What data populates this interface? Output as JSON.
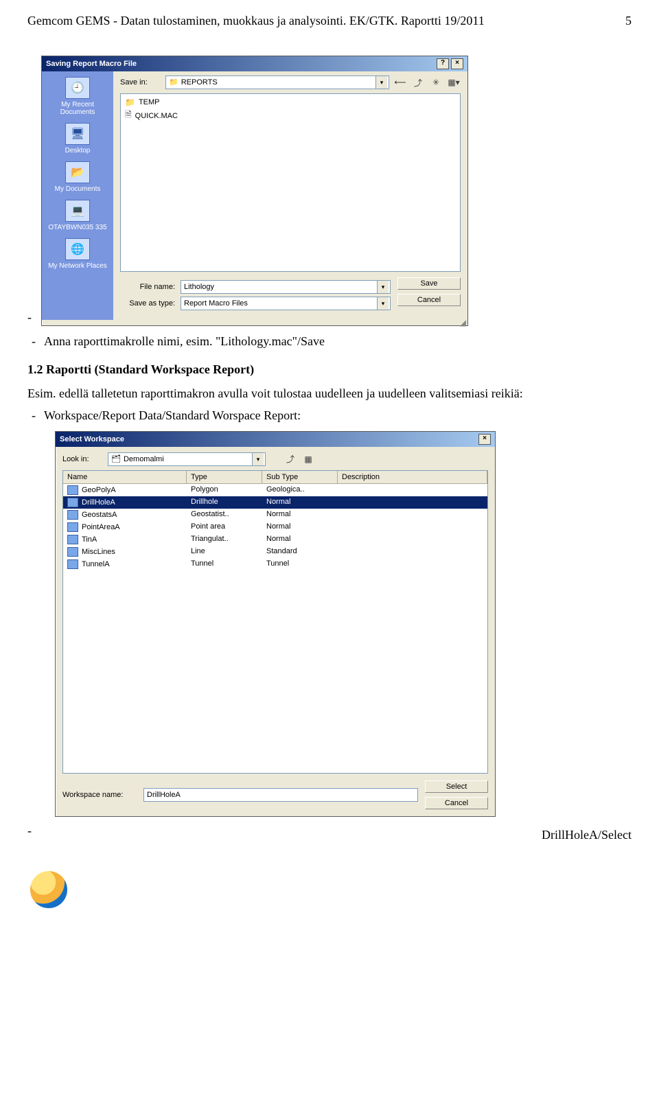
{
  "header": {
    "title": "Gemcom GEMS - Datan tulostaminen, muokkaus ja analysointi. EK/GTK. Raportti 19/2011",
    "page_number": "5"
  },
  "dlg1": {
    "title": "Saving Report Macro File",
    "save_in_label": "Save in:",
    "save_in_value": "REPORTS",
    "toolbar_icons": [
      "back-icon",
      "up-icon",
      "new-folder-icon",
      "views-icon"
    ],
    "places": [
      "My Recent Documents",
      "Desktop",
      "My Documents",
      "OTAYBWN035 335",
      "My Network Places"
    ],
    "files": [
      {
        "name": "TEMP",
        "kind": "folder"
      },
      {
        "name": "QUICK.MAC",
        "kind": "file"
      }
    ],
    "file_name_label": "File name:",
    "file_name_value": "Lithology",
    "save_type_label": "Save as type:",
    "save_type_value": "Report Macro Files",
    "save_btn": "Save",
    "cancel_btn": "Cancel"
  },
  "text": {
    "bullet_anna": "Anna raporttimakrolle nimi, esim. \"Lithology.mac\"/Save",
    "section_1_2": "1.2   Raportti  (Standard Workspace Report)",
    "esim_line": "Esim. edellä talletetun raporttimakron avulla voit tulostaa uudelleen ja uudelleen valitsemiasi reikiä:",
    "bullet_workspace": "Workspace/Report Data/Standard Worspace Report:",
    "drillhole_select": "DrillHoleA/Select"
  },
  "dlg2": {
    "title": "Select Workspace",
    "look_in_label": "Look in:",
    "look_in_value": "Demomalmi",
    "columns": [
      "Name",
      "Type",
      "Sub Type",
      "Description"
    ],
    "rows": [
      {
        "name": "GeoPolyA",
        "type": "Polygon",
        "sub": "Geologica..",
        "desc": "",
        "selected": false
      },
      {
        "name": "DrillHoleA",
        "type": "Drillhole",
        "sub": "Normal",
        "desc": "",
        "selected": true
      },
      {
        "name": "GeostatsA",
        "type": "Geostatist..",
        "sub": "Normal",
        "desc": "",
        "selected": false
      },
      {
        "name": "PointAreaA",
        "type": "Point area",
        "sub": "Normal",
        "desc": "",
        "selected": false
      },
      {
        "name": "TinA",
        "type": "Triangulat..",
        "sub": "Normal",
        "desc": "",
        "selected": false
      },
      {
        "name": "MiscLines",
        "type": "Line",
        "sub": "Standard",
        "desc": "",
        "selected": false
      },
      {
        "name": "TunnelA",
        "type": "Tunnel",
        "sub": "Tunnel",
        "desc": "",
        "selected": false
      }
    ],
    "ws_name_label": "Workspace name:",
    "ws_name_value": "DrillHoleA",
    "select_btn": "Select",
    "cancel_btn": "Cancel"
  }
}
